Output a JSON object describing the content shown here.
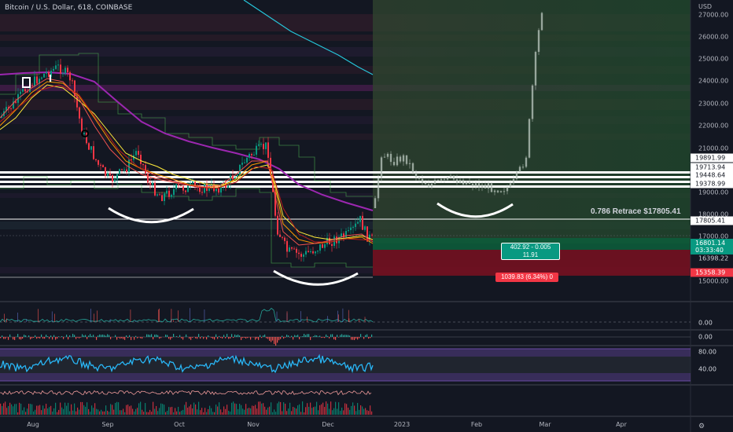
{
  "header": {
    "title": "Bitcoin / U.S. Dollar, 618, COINBASE",
    "currency": "USD"
  },
  "price_axis": {
    "labels": [
      "27000.00",
      "26000.00",
      "25000.00",
      "24000.00",
      "23000.00",
      "22000.00",
      "21000.00",
      "19000.00",
      "18000.00",
      "17000.00",
      "15000.00"
    ],
    "level_boxes": [
      {
        "value": "19891.99",
        "style": "white"
      },
      {
        "value": "19713.94",
        "style": "white"
      },
      {
        "value": "19448.64",
        "style": "white"
      },
      {
        "value": "19378.99",
        "style": "white"
      },
      {
        "value": "17805.41",
        "style": "white"
      },
      {
        "value": "16398.22",
        "style": "plain"
      },
      {
        "value": "15358.39",
        "style": "red"
      }
    ],
    "current_price": {
      "value": "16801.14",
      "countdown": "03:33:40"
    }
  },
  "annotations": {
    "retrace_label": "0.786 Retrace $17805.41",
    "measure_green": {
      "line1": "402.92 - 0.005",
      "line2": "11.91"
    },
    "measure_red": "1039.83 (6.34%) 0"
  },
  "indicator_axis": {
    "labels": [
      "0.00",
      "0.00",
      "80.00",
      "40.00"
    ]
  },
  "time_axis": {
    "labels": [
      "Aug",
      "Sep",
      "Oct",
      "Nov",
      "Dec",
      "2023",
      "Feb",
      "Mar",
      "Apr"
    ]
  },
  "colors": {
    "background": "#131722",
    "up": "#089981",
    "down": "#f23645",
    "ema_purple": "#9c27b0",
    "ema_cyan": "#26c6da",
    "ema_yellow": "#ffeb3b",
    "ema_orange": "#ff9800",
    "ema_red": "#ef5350",
    "rsi_line": "#29b6f6"
  },
  "toolbar": {
    "settings_icon": "gear-icon"
  }
}
